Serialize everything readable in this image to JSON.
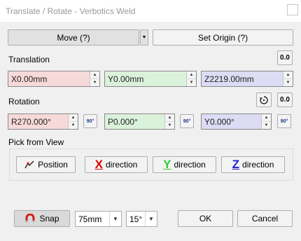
{
  "window": {
    "title": "Translate / Rotate - Verbotics Weld"
  },
  "mode": {
    "selected": "Move (?)",
    "set_origin_label": "Set Origin (?)"
  },
  "translation": {
    "label": "Translation",
    "reset_label": "0.0",
    "x": "X0.00mm",
    "y": "Y0.00mm",
    "z": "Z2219.00mm"
  },
  "rotation": {
    "label": "Rotation",
    "reset_label": "0.0",
    "r": "R270.000°",
    "p": "P0.000°",
    "y": "Y0.000°",
    "rotate90_label": "90°"
  },
  "pick": {
    "label": "Pick from View",
    "position_label": "Position",
    "x_letter": "X",
    "x_label": "direction",
    "y_letter": "Y",
    "y_label": "direction",
    "z_letter": "Z",
    "z_label": "direction"
  },
  "footer": {
    "snap_label": "Snap",
    "distance_value": "75mm",
    "angle_value": "15°",
    "ok_label": "OK",
    "cancel_label": "Cancel"
  },
  "colors": {
    "x_axis": "#e00000",
    "y_axis": "#2ad12a",
    "z_axis": "#2121d0"
  },
  "icons": [
    "close-icon",
    "dropdown-arrow-icon",
    "spin-up-icon",
    "spin-down-icon",
    "rotate-90-icon",
    "rotate-gizmo-icon",
    "pick-position-icon",
    "magnet-icon"
  ]
}
